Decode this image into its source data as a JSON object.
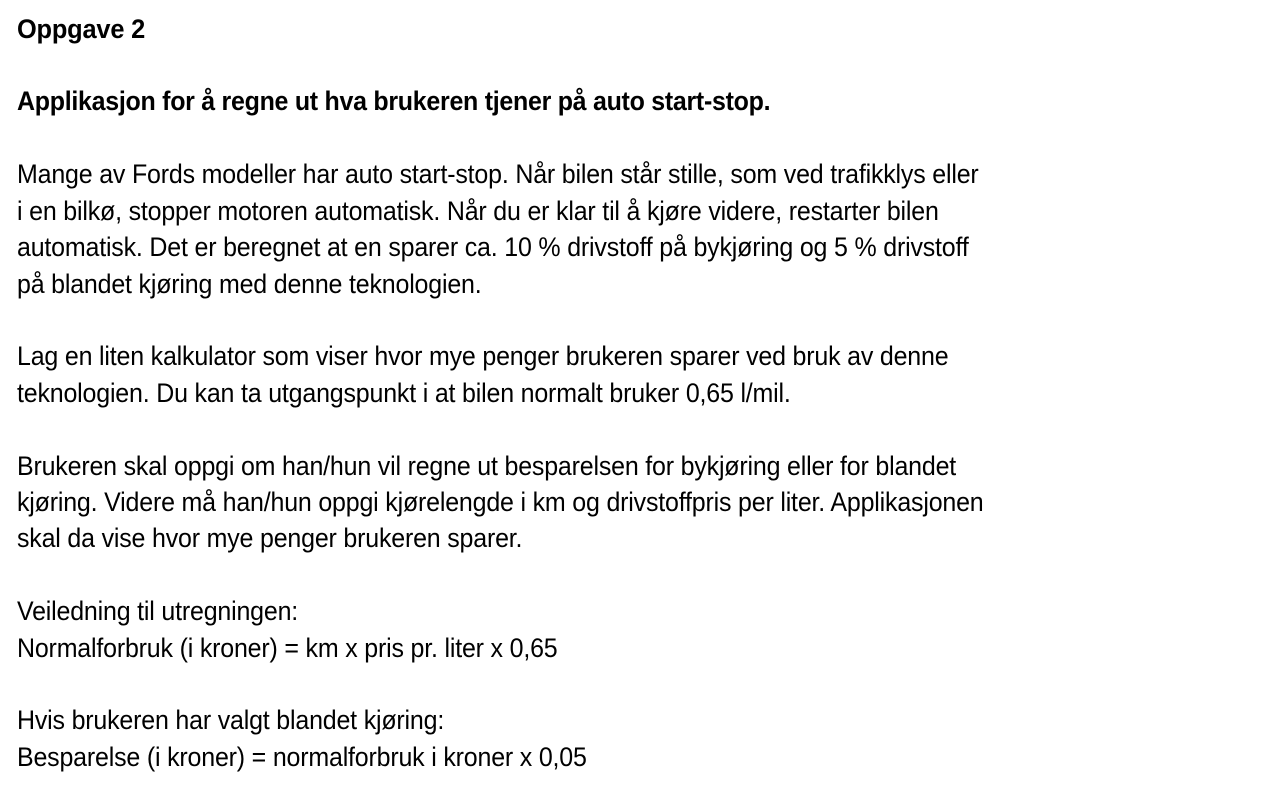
{
  "document": {
    "title": "Oppgave 2",
    "subtitle": "Applikasjon for å regne ut hva brukeren tjener på auto start-stop.",
    "paragraphs": [
      {
        "lines": [
          "Mange av Fords modeller har auto start-stop. Når bilen står stille, som ved trafikklys eller",
          "i en bilkø, stopper motoren automatisk. Når du er klar til å kjøre videre, restarter bilen",
          "automatisk. Det er beregnet at en sparer ca. 10 % drivstoff på bykjøring og 5 % drivstoff",
          "på blandet kjøring med denne teknologien."
        ]
      },
      {
        "lines": [
          "Lag en liten kalkulator som viser hvor mye penger brukeren sparer ved bruk av denne",
          "teknologien. Du kan ta utgangspunkt i at bilen normalt bruker 0,65 l/mil."
        ]
      },
      {
        "lines": [
          "Brukeren skal oppgi om han/hun vil regne ut besparelsen for bykjøring eller for blandet",
          "kjøring. Videre må han/hun oppgi kjørelengde i km og drivstoffpris per liter. Applikasjonen",
          "skal da vise hvor mye penger brukeren sparer."
        ]
      },
      {
        "lines": [
          "Veiledning til utregningen:",
          "Normalforbruk (i kroner) = km x pris pr. liter x 0,65"
        ]
      },
      {
        "lines": [
          "Hvis brukeren har valgt blandet kjøring:",
          "Besparelse (i kroner) = normalforbruk i kroner x 0,05"
        ]
      }
    ]
  }
}
